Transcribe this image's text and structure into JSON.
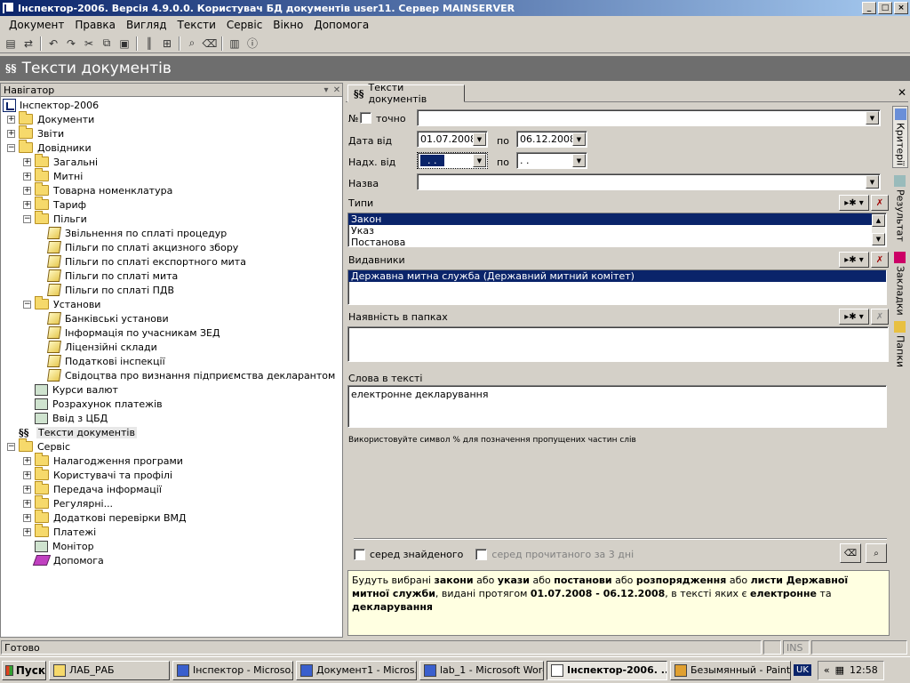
{
  "window": {
    "title": "Інспектор-2006. Версія 4.9.0.0. Користувач БД документів user11. Сервер MAINSERVER",
    "btn_min": "_",
    "btn_max": "□",
    "btn_close": "×"
  },
  "menu": [
    "Документ",
    "Правка",
    "Вигляд",
    "Тексти",
    "Сервіс",
    "Вікно",
    "Допомога"
  ],
  "header": {
    "title": "Тексти документів",
    "glyph": "§§"
  },
  "navigator": {
    "title": "Навігатор",
    "tree": [
      {
        "label": "Інспектор-2006",
        "level": 0,
        "icon": "app-icon",
        "pm": ""
      },
      {
        "label": "Документи",
        "level": 1,
        "icon": "folder-icon",
        "pm": "+"
      },
      {
        "label": "Звіти",
        "level": 1,
        "icon": "folder-icon",
        "pm": "+"
      },
      {
        "label": "Довідники",
        "level": 1,
        "icon": "folder-icon",
        "pm": "−"
      },
      {
        "label": "Загальні",
        "level": 2,
        "icon": "folder-icon",
        "pm": "+"
      },
      {
        "label": "Митні",
        "level": 2,
        "icon": "folder-icon",
        "pm": "+"
      },
      {
        "label": "Товарна номенклатура",
        "level": 2,
        "icon": "folder-icon",
        "pm": "+"
      },
      {
        "label": "Тариф",
        "level": 2,
        "icon": "folder-icon",
        "pm": "+"
      },
      {
        "label": "Пільги",
        "level": 2,
        "icon": "folder-icon",
        "pm": "−"
      },
      {
        "label": "Звільнення по сплаті процедур",
        "level": 3,
        "icon": "document-icon",
        "pm": ""
      },
      {
        "label": "Пільги по сплаті акцизного збору",
        "level": 3,
        "icon": "document-icon",
        "pm": ""
      },
      {
        "label": "Пільги по сплаті експортного мита",
        "level": 3,
        "icon": "document-icon",
        "pm": ""
      },
      {
        "label": "Пільги по сплаті мита",
        "level": 3,
        "icon": "document-icon",
        "pm": ""
      },
      {
        "label": "Пільги по сплаті ПДВ",
        "level": 3,
        "icon": "document-icon",
        "pm": ""
      },
      {
        "label": "Установи",
        "level": 2,
        "icon": "folder-icon",
        "pm": "−"
      },
      {
        "label": "Банківські установи",
        "level": 3,
        "icon": "document-icon",
        "pm": ""
      },
      {
        "label": "Інформація по учасникам ЗЕД",
        "level": 3,
        "icon": "document-icon",
        "pm": ""
      },
      {
        "label": "Ліцензійні склади",
        "level": 3,
        "icon": "document-icon",
        "pm": ""
      },
      {
        "label": "Податкові інспекції",
        "level": 3,
        "icon": "document-icon",
        "pm": ""
      },
      {
        "label": "Свідоцтва про визнання підприємства декларантом",
        "level": 3,
        "icon": "document-icon",
        "pm": ""
      },
      {
        "label": "Курси валют",
        "level": 2,
        "icon": "currency-icon",
        "pm": ""
      },
      {
        "label": "Розрахунок платежів",
        "level": 2,
        "icon": "calculator-icon",
        "pm": ""
      },
      {
        "label": "Ввід з ЦБД",
        "level": 2,
        "icon": "import-icon",
        "pm": ""
      },
      {
        "label": "Тексти документів",
        "level": 1,
        "icon": "texts-icon",
        "pm": "",
        "selected": true
      },
      {
        "label": "Сервіс",
        "level": 1,
        "icon": "folder-icon",
        "pm": "−"
      },
      {
        "label": "Налагодження програми",
        "level": 2,
        "icon": "folder-icon",
        "pm": "+"
      },
      {
        "label": "Користувачі та профілі",
        "level": 2,
        "icon": "folder-icon",
        "pm": "+"
      },
      {
        "label": "Передача інформації",
        "level": 2,
        "icon": "folder-icon",
        "pm": "+"
      },
      {
        "label": "Регулярні...",
        "level": 2,
        "icon": "folder-icon",
        "pm": "+"
      },
      {
        "label": "Додаткові перевірки ВМД",
        "level": 2,
        "icon": "folder-icon",
        "pm": "+"
      },
      {
        "label": "Платежі",
        "level": 2,
        "icon": "folder-icon",
        "pm": "+"
      },
      {
        "label": "Монітор",
        "level": 2,
        "icon": "monitor-icon",
        "pm": ""
      },
      {
        "label": "Допомога",
        "level": 2,
        "icon": "book-icon",
        "pm": ""
      }
    ]
  },
  "tab": {
    "label": "Тексти документів",
    "glyph": "§§"
  },
  "form": {
    "num_label": "№",
    "exact_label": "точно",
    "date_label": "Дата від",
    "date_from": "01.07.2008",
    "to_label": "по",
    "date_to": "06.12.2008",
    "recv_label": "Надх. від",
    "recv_from": ". .",
    "recv_to": ". .",
    "name_label": "Назва",
    "types_label": "Типи",
    "types": [
      "Закон",
      "Указ",
      "Постанова"
    ],
    "issuers_label": "Видавники",
    "issuers": [
      "Державна митна служба (Державний митний комітет)"
    ],
    "folders_label": "Наявність в папках",
    "words_label": "Слова в тексті",
    "words_value": "електронне декларування",
    "hint": "Використовуйте символ % для позначення пропущених частин слів",
    "among_found": "серед знайденого",
    "among_read": "серед прочитаного за 3 дні"
  },
  "result": {
    "p1": "Будуть вибрані ",
    "b1": "закони",
    "p2": " або ",
    "b2": "укази",
    "p3": " або ",
    "b3": "постанови",
    "p4": " або ",
    "b4": "розпорядження",
    "p5": " або ",
    "b5": "листи Державної митної служби",
    "p6": ", видані протягом ",
    "b6": "01.07.2008 - 06.12.2008",
    "p7": ", в тексті яких є ",
    "b7": "електронне",
    "p8": " та ",
    "b8": "декларування"
  },
  "side_tabs": [
    "Критерії",
    "Результат",
    "Закладки",
    "Папки"
  ],
  "status": {
    "text": "Готово",
    "ins": "INS"
  },
  "taskbar": {
    "start": "Пуск",
    "tasks": [
      "ЛАБ_РАБ",
      "Інспектор - Microso...",
      "Документ1 - Micros...",
      "lab_1 - Microsoft Word",
      "Інспектор-2006. ...",
      "Безымянный - Paint"
    ],
    "lang": "UK",
    "clock": "12:58"
  }
}
